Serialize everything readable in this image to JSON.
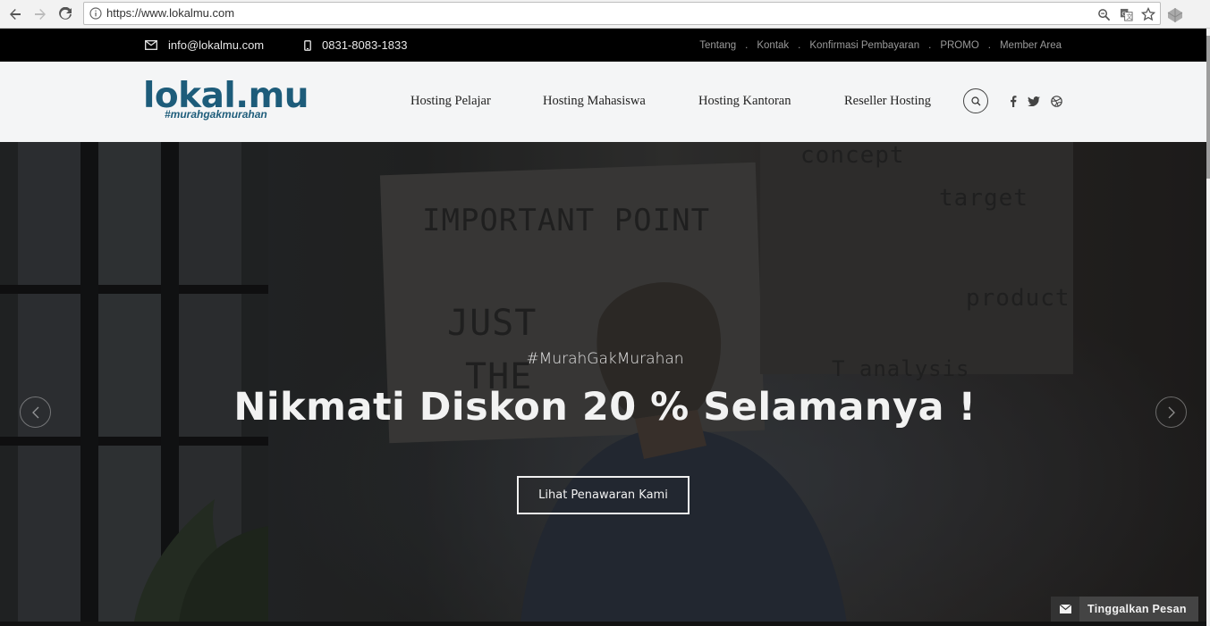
{
  "browser": {
    "url": "https://www.lokalmu.com",
    "icons": [
      "back-icon",
      "forward-icon",
      "reload-icon",
      "info-icon",
      "zoom-icon",
      "translate-icon",
      "star-icon",
      "extension-icon"
    ]
  },
  "topbar": {
    "email": "info@lokalmu.com",
    "phone": "0831-8083-1833",
    "links": [
      "Tentang",
      "Kontak",
      "Konfirmasi Pembayaran",
      "PROMO",
      "Member Area"
    ],
    "separator": "."
  },
  "header": {
    "logo_main": "lokal.mu",
    "logo_tagline": "#murahgakmurahan",
    "menu": [
      "Hosting Pelajar",
      "Hosting Mahasiswa",
      "Hosting Kantoran",
      "Reseller Hosting"
    ],
    "social_icons": [
      "facebook-icon",
      "twitter-icon",
      "dribbble-icon"
    ]
  },
  "hero": {
    "tagline": "#MurahGakMurahan",
    "title": "Nikmati Diskon 20 % Selamanya !",
    "button": "Lihat Penawaran Kami",
    "board_text": [
      "IMPORTANT POINT",
      "JUST",
      "THE",
      "concept",
      "target",
      "product",
      "T analysis"
    ]
  },
  "chat": {
    "label": "Tinggalkan Pesan"
  },
  "colors": {
    "brand": "#1d5c7a",
    "topbar": "#000000",
    "header_bg": "#f4f5f6"
  }
}
